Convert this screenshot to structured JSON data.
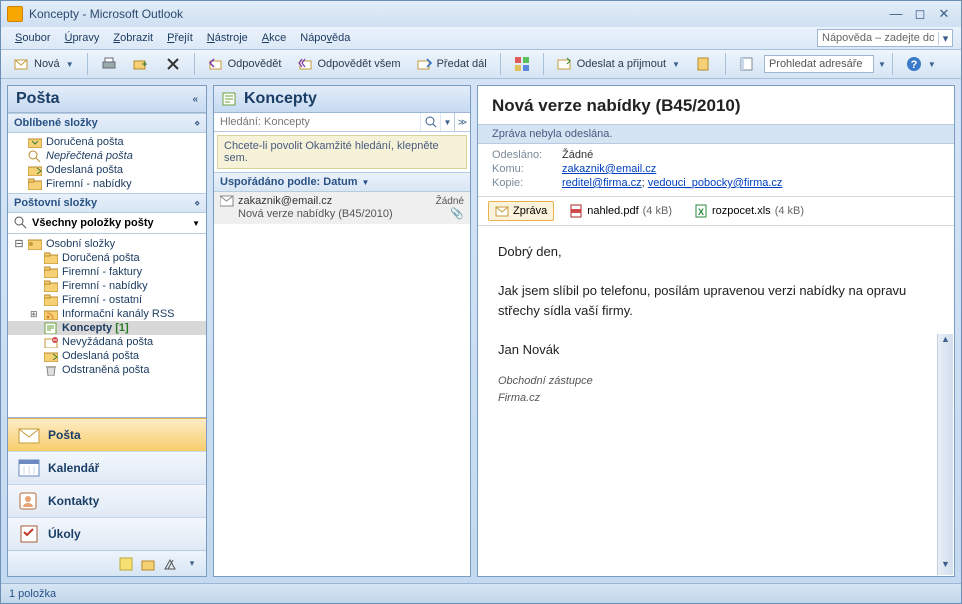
{
  "window": {
    "title": "Koncepty - Microsoft Outlook"
  },
  "menu": {
    "items": [
      "Soubor",
      "Úpravy",
      "Zobrazit",
      "Přejít",
      "Nástroje",
      "Akce",
      "Nápověda"
    ],
    "help_placeholder": "Nápověda – zadejte dotaz"
  },
  "toolbar": {
    "new": "Nová",
    "reply": "Odpovědět",
    "reply_all": "Odpovědět všem",
    "forward": "Předat dál",
    "send_receive": "Odeslat a přijmout",
    "search_addr_placeholder": "Prohledat adresáře"
  },
  "nav": {
    "header": "Pošta",
    "fav_header": "Oblíbené složky",
    "favorites": [
      {
        "label": "Doručená pošta",
        "icon": "inbox"
      },
      {
        "label": "Nepřečtená pošta",
        "icon": "search",
        "italic": true
      },
      {
        "label": "Odeslaná pošta",
        "icon": "sent"
      },
      {
        "label": "Firemní - nabídky",
        "icon": "folder"
      }
    ],
    "mail_header": "Poštovní složky",
    "scope": "Všechny položky pošty",
    "tree_root": "Osobní složky",
    "tree": [
      {
        "label": "Doručená pošta",
        "icon": "folder"
      },
      {
        "label": "Firemní - faktury",
        "icon": "folder"
      },
      {
        "label": "Firemní - nabídky",
        "icon": "folder"
      },
      {
        "label": "Firemní - ostatní",
        "icon": "folder"
      },
      {
        "label": "Informační kanály RSS",
        "icon": "rss",
        "expando": "+"
      },
      {
        "label": "Koncepty",
        "suffix": "[1]",
        "icon": "draft",
        "selected": true,
        "bold": true
      },
      {
        "label": "Nevyžádaná pošta",
        "icon": "junk"
      },
      {
        "label": "Odeslaná pošta",
        "icon": "sent"
      },
      {
        "label": "Odstraněná pošta",
        "icon": "trash"
      }
    ],
    "buttons": [
      "Pošta",
      "Kalendář",
      "Kontakty",
      "Úkoly"
    ]
  },
  "list": {
    "header": "Koncepty",
    "search_placeholder": "Hledání: Koncepty",
    "info_bar": "Chcete-li povolit Okamžité hledání, klepněte sem.",
    "sort_label": "Uspořádáno podle: Datum",
    "items": [
      {
        "from": "zakaznik@email.cz",
        "date": "Žádné",
        "subject": "Nová verze nabídky (B45/2010)",
        "has_attach": true
      }
    ]
  },
  "reading": {
    "subject": "Nová verze nabídky (B45/2010)",
    "warn": "Zpráva nebyla odeslána.",
    "sent_label": "Odesláno:",
    "sent_val": "Žádné",
    "to_label": "Komu:",
    "to_val": "zakaznik@email.cz",
    "cc_label": "Kopie:",
    "cc_val1": "reditel@firma.cz",
    "cc_sep": "; ",
    "cc_val2": "vedouci_pobocky@firma.cz",
    "attach_msg": "Zpráva",
    "attachments": [
      {
        "name": "nahled.pdf",
        "size": "(4 kB)",
        "type": "pdf"
      },
      {
        "name": "rozpocet.xls",
        "size": "(4 kB)",
        "type": "xls"
      }
    ],
    "body_greeting": "Dobrý den,",
    "body_para": "Jak jsem slíbil po telefonu, posílám upravenou verzi nabídky na opravu střechy sídla vaší firmy.",
    "body_name": "Jan Novák",
    "sig_title": "Obchodní zástupce",
    "sig_company": "Firma.cz"
  },
  "status": "1 položka"
}
